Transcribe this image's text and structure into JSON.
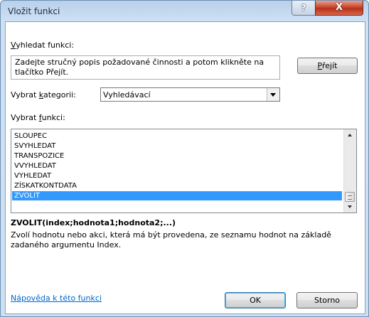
{
  "window": {
    "title": "Vložit funkci",
    "help_glyph": "?",
    "close_glyph": "X"
  },
  "search": {
    "label_accel": "V",
    "label_rest": "yhledat funkci:",
    "description": "Zadejte stručný popis požadované činnosti a potom klikněte na tlačítko Přejít.",
    "go_button_accel": "P",
    "go_button_rest": "řejít"
  },
  "category": {
    "label_prefix": "Vybrat ",
    "label_accel": "k",
    "label_rest": "ategorii:",
    "selected": "Vyhledávací"
  },
  "functions": {
    "label_prefix": "Vybrat ",
    "label_accel": "f",
    "label_rest": "unkci:",
    "items": [
      "SLOUPEC",
      "SVYHLEDAT",
      "TRANSPOZICE",
      "VVYHLEDAT",
      "VYHLEDAT",
      "ZÍSKATKONTDATA",
      "ZVOLIT"
    ],
    "selected_index": 6
  },
  "details": {
    "syntax": "ZVOLIT(index;hodnota1;hodnota2;...)",
    "description": "Zvolí hodnotu nebo akci, která má být provedena, ze seznamu hodnot na základě zadaného argumentu Index."
  },
  "footer": {
    "help_link": "Nápověda k této funkci",
    "ok_label": "OK",
    "cancel_label": "Storno"
  },
  "colors": {
    "selection": "#3399ff",
    "link": "#0066cc",
    "close_button": "#c8472c"
  }
}
